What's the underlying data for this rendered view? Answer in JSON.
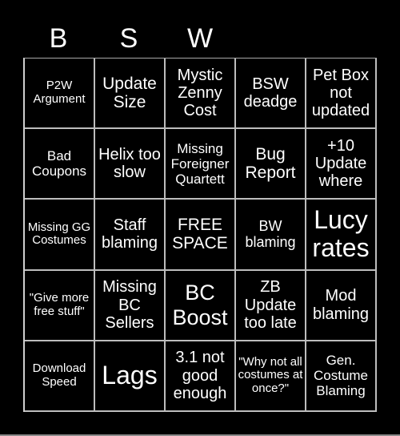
{
  "card": {
    "header_letters": [
      "B",
      "S",
      "W",
      "",
      ""
    ],
    "cells": [
      [
        "P2W Argument",
        "Update Size",
        "Mystic Zenny Cost",
        "BSW deadge",
        "Pet Box not updated"
      ],
      [
        "Bad Coupons",
        "Helix too slow",
        "Missing Foreigner Quartett",
        "Bug Report",
        "+10 Update where"
      ],
      [
        "Missing GG Costumes",
        "Staff blaming",
        "FREE SPACE",
        "BW blaming",
        "Lucy rates"
      ],
      [
        "\"Give more free stuff\"",
        "Missing BC Sellers",
        "BC Boost",
        "ZB Update too late",
        "Mod blaming"
      ],
      [
        "Download Speed",
        "Lags",
        "3.1 not good enough",
        "\"Why not all costumes at once?\"",
        "Gen. Costume Blaming"
      ]
    ]
  },
  "colors": {
    "background": "#000000",
    "text": "#ffffff",
    "grid_line": "#bdbdbd"
  }
}
